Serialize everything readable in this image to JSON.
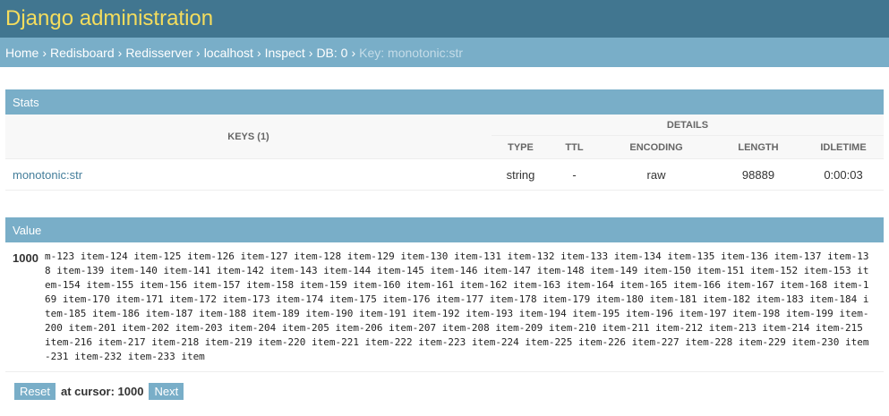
{
  "header": {
    "title": "Django administration"
  },
  "breadcrumbs": [
    "Home",
    "Redisboard",
    "Redisserver",
    "localhost",
    "Inspect",
    "DB: 0"
  ],
  "breadcrumb_current": "Key: monotonic:str",
  "breadcrumb_separator": "›",
  "stats": {
    "caption": "Stats",
    "keys_header": "KEYS (1)",
    "details_header": "DETAILS",
    "columns": [
      "TYPE",
      "TTL",
      "ENCODING",
      "LENGTH",
      "IDLETIME"
    ],
    "row": {
      "key": "monotonic:str",
      "type": "string",
      "ttl": "-",
      "encoding": "raw",
      "length": "98889",
      "idletime": "0:00:03"
    }
  },
  "value": {
    "caption": "Value",
    "index": "1000",
    "text": "m-123 item-124 item-125 item-126 item-127 item-128 item-129 item-130 item-131 item-132 item-133 item-134 item-135 item-136 item-137 item-138 item-139 item-140 item-141 item-142 item-143 item-144 item-145 item-146 item-147 item-148 item-149 item-150 item-151 item-152 item-153 item-154 item-155 item-156 item-157 item-158 item-159 item-160 item-161 item-162 item-163 item-164 item-165 item-166 item-167 item-168 item-169 item-170 item-171 item-172 item-173 item-174 item-175 item-176 item-177 item-178 item-179 item-180 item-181 item-182 item-183 item-184 item-185 item-186 item-187 item-188 item-189 item-190 item-191 item-192 item-193 item-194 item-195 item-196 item-197 item-198 item-199 item-200 item-201 item-202 item-203 item-204 item-205 item-206 item-207 item-208 item-209 item-210 item-211 item-212 item-213 item-214 item-215 item-216 item-217 item-218 item-219 item-220 item-221 item-222 item-223 item-224 item-225 item-226 item-227 item-228 item-229 item-230 item-231 item-232 item-233 item"
  },
  "pager": {
    "reset_label": "Reset",
    "cursor_text": "at cursor: 1000",
    "next_label": "Next"
  },
  "colors": {
    "header_bg": "#417690",
    "title": "#f5dd5d",
    "accent": "#79aec8",
    "link": "#447e9b"
  }
}
